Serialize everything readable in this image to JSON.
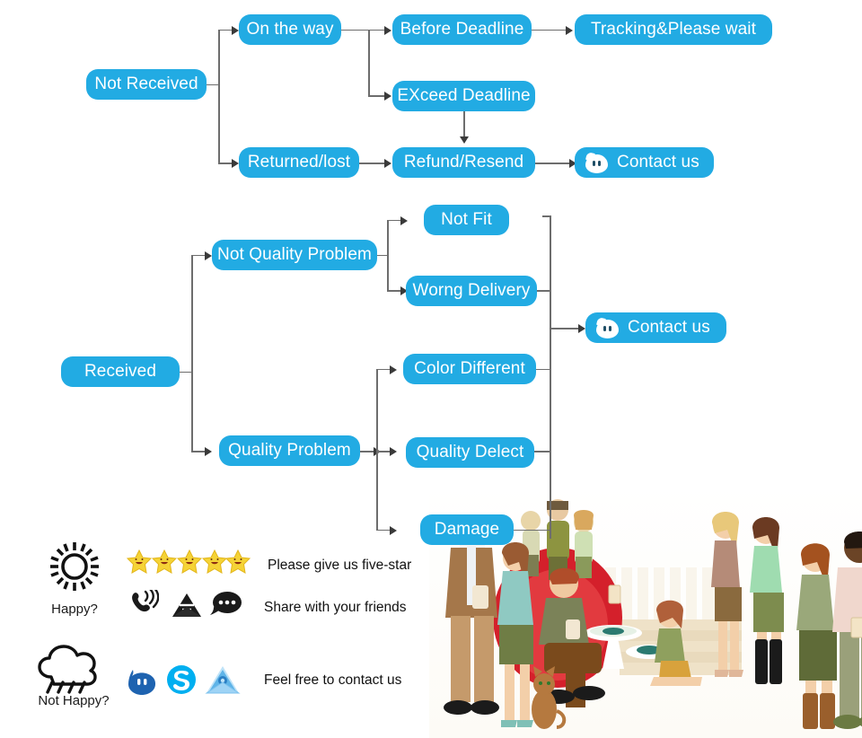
{
  "theme": {
    "node_blue": "#22ABE3",
    "node_text": "#ffffff",
    "connector": "#6d6d6d",
    "arrow": "#3a3a3a",
    "star_yellow": "#F7D13A",
    "skype_blue": "#00AFF0",
    "chat_blue": "#1E63B0",
    "envelope_blue": "#6FC3F0",
    "body_text": "#111111",
    "background": "#ffffff"
  },
  "flow_not_received": {
    "root": "Not Received",
    "nodes": {
      "on_the_way": "On the way",
      "before_deadline": "Before Deadline",
      "tracking": "Tracking&Please wait",
      "exceed_deadline": "EXceed Deadline",
      "returned_lost": "Returned/lost",
      "refund_resend": "Refund/Resend",
      "contact_us": "Contact us"
    }
  },
  "flow_received": {
    "root": "Received",
    "nodes": {
      "not_quality_problem": "Not Quality Problem",
      "not_fit": "Not Fit",
      "wrong_delivery": "Worng Delivery",
      "quality_problem": "Quality Problem",
      "color_different": "Color Different",
      "quality_defect": "Quality Delect",
      "damage": "Damage",
      "contact_us": "Contact us"
    }
  },
  "footer": {
    "happy_label": "Happy?",
    "not_happy_label": "Not Happy?",
    "messages": {
      "five_star": "Please give us five-star",
      "share": "Share with your friends",
      "contact": "Feel free to contact us"
    },
    "star_count": 5,
    "icons": {
      "sun": "sun-icon",
      "rain_cloud": "rain-cloud-icon",
      "star": "smiling-star-icon",
      "phone": "phone-ring-icon",
      "mail": "envelope-icon",
      "speech": "speech-bubble-icon",
      "trademanager": "trademanager-chat-icon",
      "skype": "skype-icon",
      "email": "blue-envelope-icon"
    }
  },
  "illustration": {
    "name": "party-people-illustration",
    "description": "Cartoon crowd of people holding drinks on steps"
  }
}
